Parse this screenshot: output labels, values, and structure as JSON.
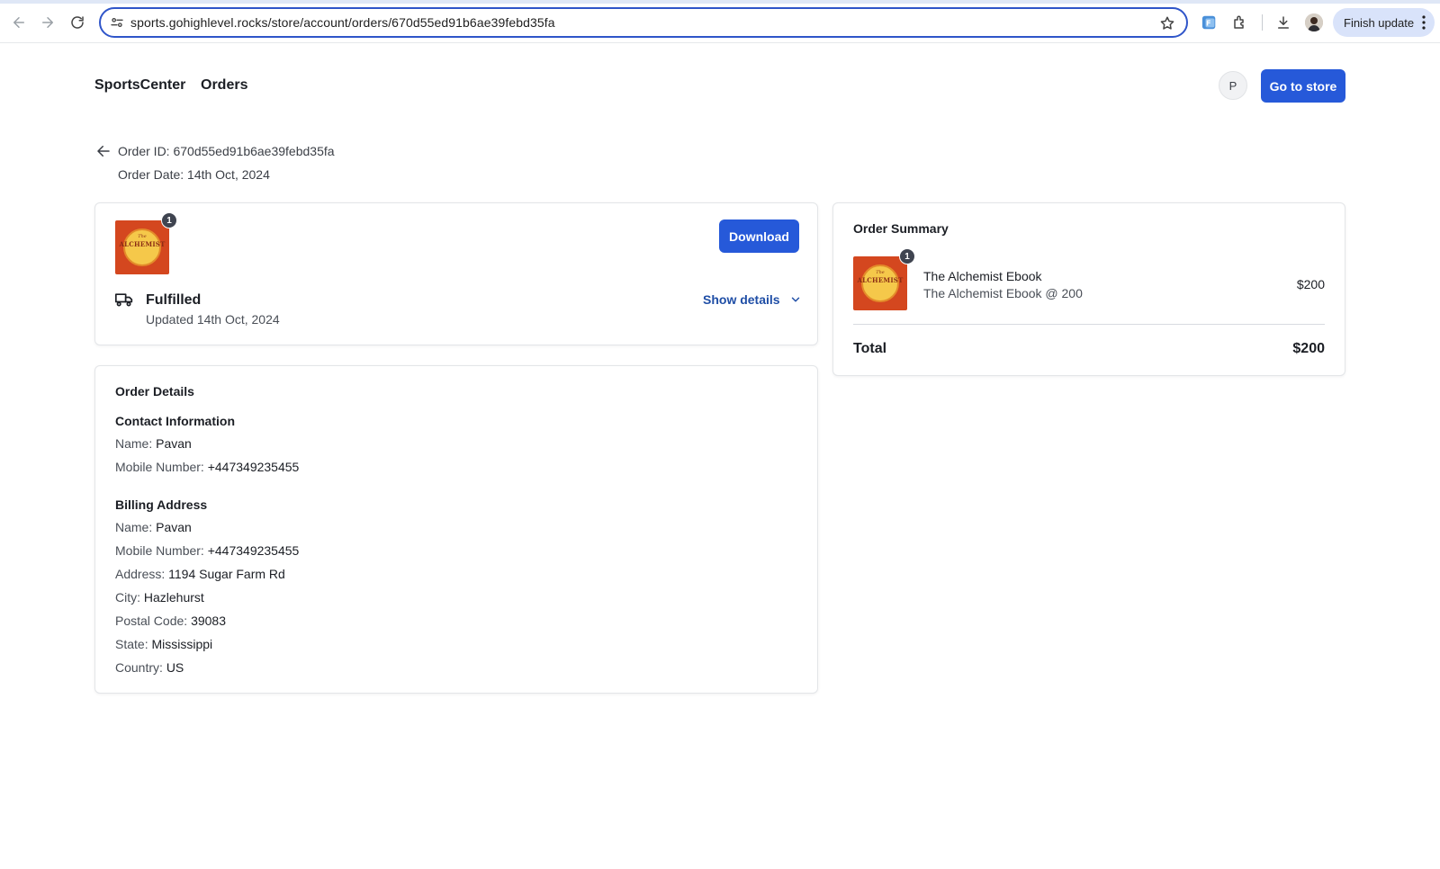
{
  "browser": {
    "url": "sports.gohighlevel.rocks/store/account/orders/670d55ed91b6ae39febd35fa",
    "finish_update_label": "Finish update"
  },
  "header": {
    "brand": "SportsCenter",
    "nav_orders": "Orders",
    "avatar_initial": "P",
    "go_to_store_label": "Go to store"
  },
  "order": {
    "id_line": "Order ID: 670d55ed91b6ae39febd35fa",
    "date_line": "Order Date: 14th Oct, 2024"
  },
  "fulfillment": {
    "cover_the": "The",
    "cover_title": "ALCHEMIST",
    "quantity": "1",
    "download_label": "Download",
    "status": "Fulfilled",
    "updated": "Updated 14th Oct, 2024",
    "show_details_label": "Show details"
  },
  "details": {
    "title": "Order Details",
    "contact": {
      "title": "Contact Information",
      "name_label": "Name:",
      "name": "Pavan",
      "mobile_label": "Mobile Number:",
      "mobile": "+447349235455"
    },
    "billing": {
      "title": "Billing Address",
      "name_label": "Name:",
      "name": "Pavan",
      "mobile_label": "Mobile Number:",
      "mobile": "+447349235455",
      "address_label": "Address:",
      "address": "1194 Sugar Farm Rd",
      "city_label": "City:",
      "city": "Hazlehurst",
      "postal_label": "Postal Code:",
      "postal": "39083",
      "state_label": "State:",
      "state": "Mississippi",
      "country_label": "Country:",
      "country": "US"
    }
  },
  "summary": {
    "title": "Order Summary",
    "item_name": "The Alchemist Ebook",
    "item_sub": "The Alchemist Ebook @ 200",
    "item_price": "$200",
    "quantity": "1",
    "total_label": "Total",
    "total_value": "$200"
  },
  "colors": {
    "primary": "#2659d9",
    "link": "#1f4ea6"
  }
}
